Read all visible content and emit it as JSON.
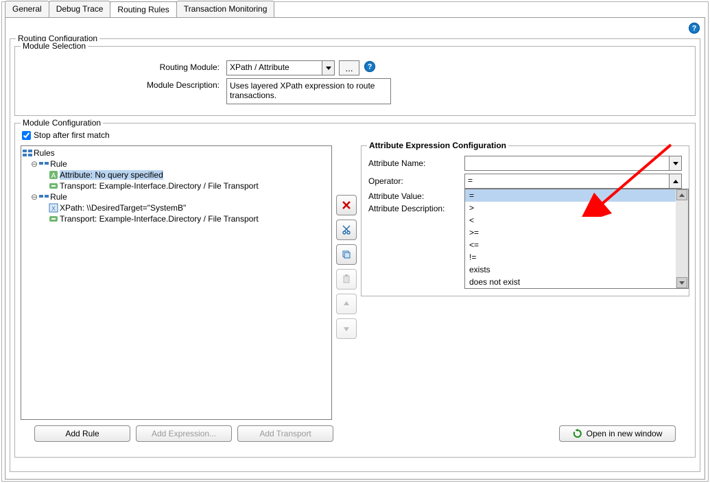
{
  "tabs": {
    "general": "General",
    "debug": "Debug Trace",
    "routing": "Routing Rules",
    "tx": "Transaction Monitoring"
  },
  "routing_config_legend": "Routing Configuration",
  "module_selection": {
    "legend": "Module Selection",
    "routing_module_label": "Routing Module:",
    "routing_module_value": "XPath / Attribute",
    "browse_label": "...",
    "module_description_label": "Module Description:",
    "module_description_value": "Uses layered XPath expression to route transactions."
  },
  "module_config": {
    "legend": "Module Configuration",
    "stop_after_label": "Stop after first match",
    "stop_after_checked": true
  },
  "tree": {
    "root": "Rules",
    "rule1": "Rule",
    "rule1_attr": "Attribute: No query specified",
    "rule1_trans": "Transport: Example-Interface.Directory / File Transport",
    "rule2": "Rule",
    "rule2_xpath": "XPath: \\\\DesiredTarget=\"SystemB\"",
    "rule2_trans": "Transport: Example-Interface.Directory / File Transport"
  },
  "attr_config": {
    "legend": "Attribute Expression Configuration",
    "name_label": "Attribute Name:",
    "name_value": "",
    "operator_label": "Operator:",
    "operator_value": "=",
    "value_label": "Attribute Value:",
    "description_label": "Attribute Description:",
    "operator_options": [
      "=",
      ">",
      "<",
      ">=",
      "<=",
      "!=",
      "exists",
      "does not exist"
    ]
  },
  "buttons": {
    "add_rule": "Add Rule",
    "add_expr": "Add Expression...",
    "add_transport": "Add Transport",
    "open_window": "Open in new window"
  }
}
